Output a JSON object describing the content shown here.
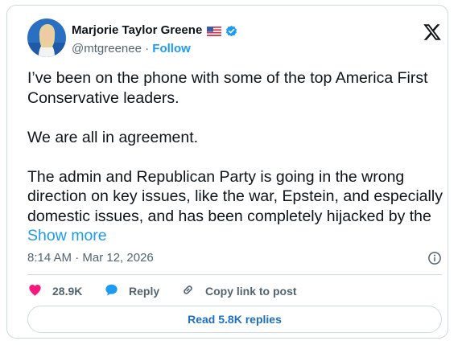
{
  "author": {
    "name": "Marjorie Taylor Greene",
    "handle": "@mtgreenee",
    "separator": "·",
    "follow_label": "Follow",
    "flag_icon": "us-flag-icon",
    "verified_icon": "verified-badge-icon"
  },
  "platform_icon": "x-logo-icon",
  "tweet": {
    "paragraphs": [
      "I’ve been on the phone with some of the top America First Conservative leaders.",
      "We are all in agreement.",
      "The admin and Republican Party is going in the wrong direction on key issues, like the war, Epstein, and especially domestic issues, and has been completely hijacked by the "
    ],
    "show_more_label": "Show more"
  },
  "timestamp": "8:14 AM · Mar 12, 2026",
  "actions": {
    "likes_count": "28.9K",
    "reply_label": "Reply",
    "copy_link_label": "Copy link to post"
  },
  "read_replies_label": "Read 5.8K replies",
  "colors": {
    "accent": "#1d9bf0",
    "like": "#f91880",
    "text": "#0f1419",
    "muted": "#536471",
    "border": "#cfd9de"
  }
}
